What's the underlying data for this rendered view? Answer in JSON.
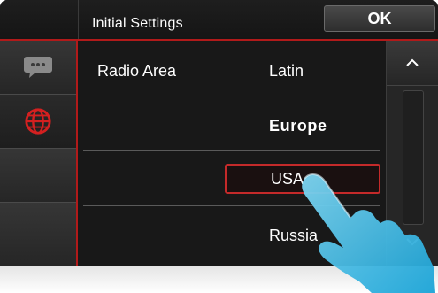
{
  "header": {
    "title": "Initial Settings",
    "ok_label": "OK"
  },
  "sidebar": {
    "items": [
      {
        "icon": "chat-bubble-icon",
        "active": false
      },
      {
        "icon": "globe-icon",
        "active": true
      },
      {
        "icon": "",
        "active": false
      },
      {
        "icon": "",
        "active": false
      }
    ]
  },
  "content": {
    "label": "Radio Area",
    "options": [
      {
        "label": "Latin",
        "state": "normal"
      },
      {
        "label": "Europe",
        "state": "current"
      },
      {
        "label": "USA",
        "state": "selected"
      },
      {
        "label": "Russia",
        "state": "normal"
      }
    ]
  },
  "scrollbar": {
    "up_icon": "chevron-up-icon",
    "down_icon": "chevron-down-icon"
  },
  "colors": {
    "accent": "#b11a1a",
    "globe": "#d42020",
    "hand": "#29b6e6",
    "background": "#181818"
  }
}
